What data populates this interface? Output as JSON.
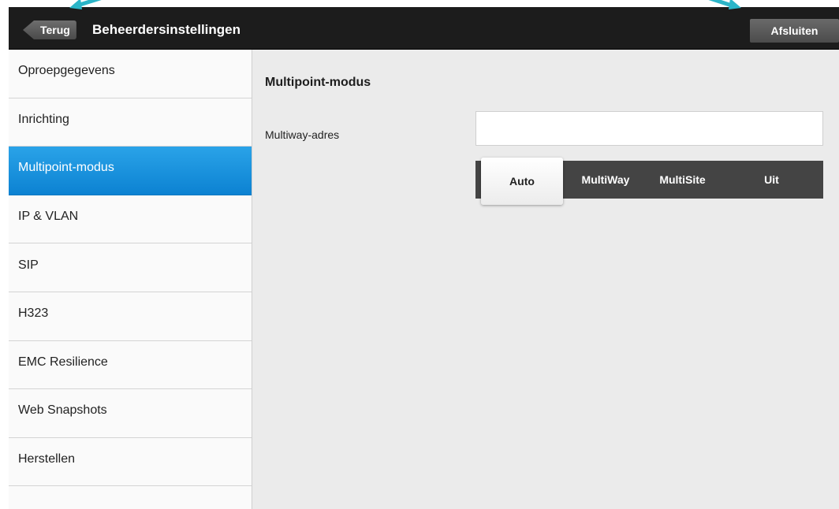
{
  "header": {
    "back_label": "Terug",
    "title": "Beheerdersinstellingen",
    "exit_label": "Afsluiten"
  },
  "sidebar": {
    "items": [
      {
        "label": "Oproepgegevens"
      },
      {
        "label": "Inrichting"
      },
      {
        "label": "Multipoint-modus",
        "active": true
      },
      {
        "label": "IP & VLAN"
      },
      {
        "label": "SIP"
      },
      {
        "label": "H323"
      },
      {
        "label": "EMC Resilience"
      },
      {
        "label": "Web Snapshots"
      },
      {
        "label": "Herstellen"
      },
      {
        "label": ""
      }
    ]
  },
  "main": {
    "section_title": "Multipoint-modus",
    "multiway_label": "Multiway-adres",
    "multiway_value": "",
    "modes": [
      "Auto",
      "MultiWay",
      "MultiSite",
      "Uit"
    ],
    "selected_mode": "Auto"
  },
  "colors": {
    "accent": "#1a93de",
    "topbar": "#1c1c1c",
    "annotation_arrow": "#2bb5c8"
  },
  "icons": {
    "back": "chevron-left-icon",
    "annotation": "callout-arrow-icon"
  }
}
